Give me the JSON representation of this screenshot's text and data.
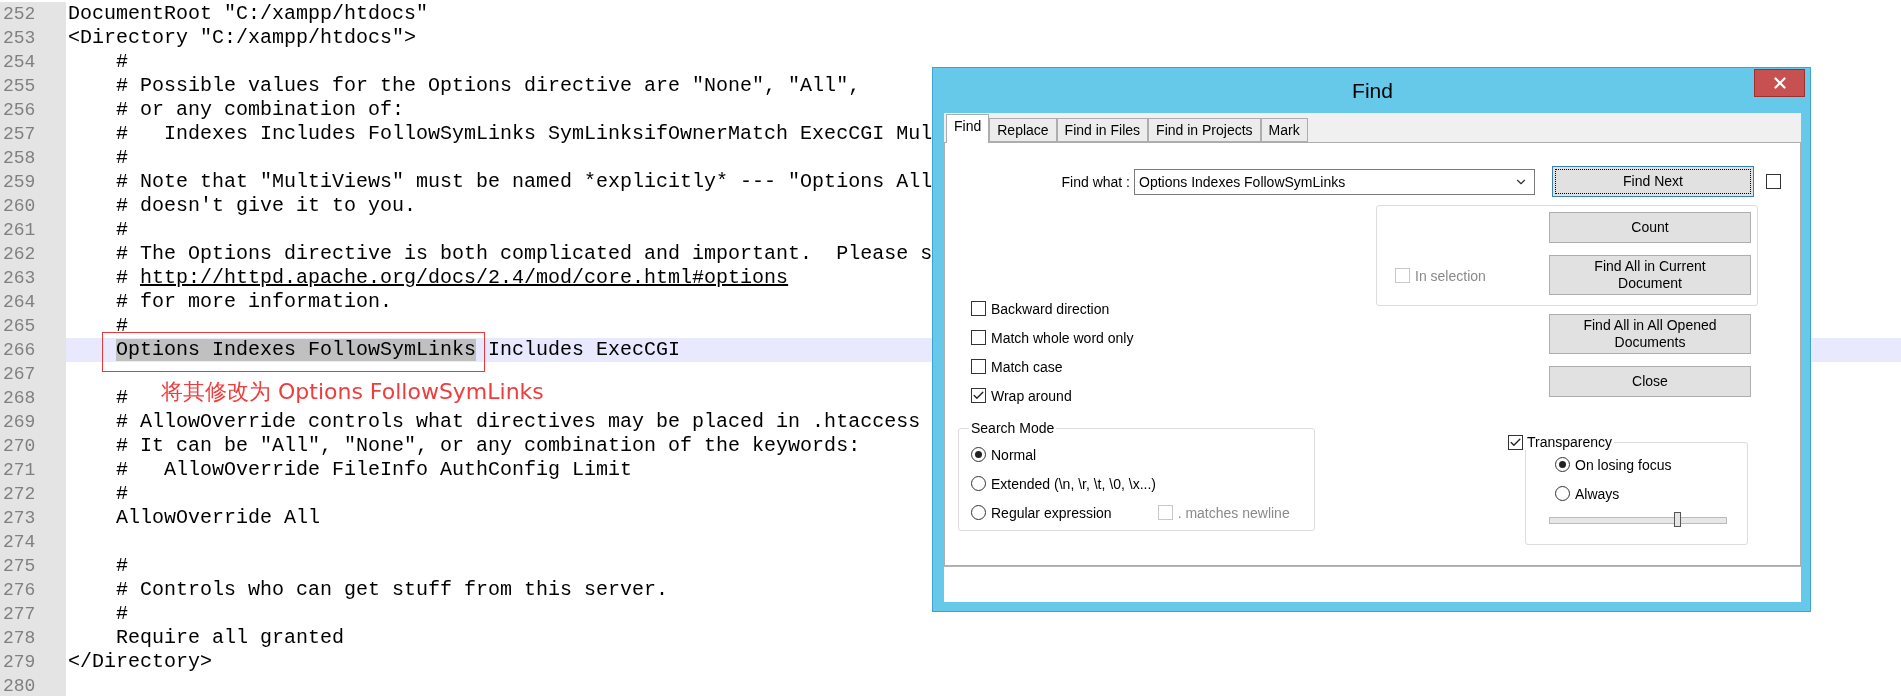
{
  "editor": {
    "lines": [
      {
        "number": "252",
        "current": false,
        "segments": [
          {
            "kind": "plain",
            "text": "DocumentRoot \"C:/xampp/htdocs\""
          }
        ]
      },
      {
        "number": "253",
        "current": false,
        "segments": [
          {
            "kind": "plain",
            "text": "<Directory \"C:/xampp/htdocs\">"
          }
        ]
      },
      {
        "number": "254",
        "current": false,
        "segments": [
          {
            "kind": "plain",
            "text": "    #"
          }
        ]
      },
      {
        "number": "255",
        "current": false,
        "segments": [
          {
            "kind": "plain",
            "text": "    # Possible values for the Options directive are \"None\", \"All\","
          }
        ]
      },
      {
        "number": "256",
        "current": false,
        "segments": [
          {
            "kind": "plain",
            "text": "    # or any combination of:"
          }
        ]
      },
      {
        "number": "257",
        "current": false,
        "segments": [
          {
            "kind": "plain",
            "text": "    #   Indexes Includes FollowSymLinks SymLinksifOwnerMatch ExecCGI Mul"
          }
        ]
      },
      {
        "number": "258",
        "current": false,
        "segments": [
          {
            "kind": "plain",
            "text": "    #"
          }
        ]
      },
      {
        "number": "259",
        "current": false,
        "segments": [
          {
            "kind": "plain",
            "text": "    # Note that \"MultiViews\" must be named *explicitly* --- \"Options All"
          }
        ]
      },
      {
        "number": "260",
        "current": false,
        "segments": [
          {
            "kind": "plain",
            "text": "    # doesn't give it to you."
          }
        ]
      },
      {
        "number": "261",
        "current": false,
        "segments": [
          {
            "kind": "plain",
            "text": "    #"
          }
        ]
      },
      {
        "number": "262",
        "current": false,
        "segments": [
          {
            "kind": "plain",
            "text": "    # The Options directive is both complicated and important.  Please s"
          }
        ]
      },
      {
        "number": "263",
        "current": false,
        "segments": [
          {
            "kind": "plain",
            "text": "    # "
          },
          {
            "kind": "link",
            "text": "http://httpd.apache.org/docs/2.4/mod/core.html#options"
          }
        ]
      },
      {
        "number": "264",
        "current": false,
        "segments": [
          {
            "kind": "plain",
            "text": "    # for more information."
          }
        ]
      },
      {
        "number": "265",
        "current": false,
        "segments": [
          {
            "kind": "plain",
            "text": "    #"
          }
        ]
      },
      {
        "number": "266",
        "current": true,
        "indented": true,
        "segments": [
          {
            "kind": "selection",
            "text": "Options Indexes FollowSymLinks"
          },
          {
            "kind": "plain",
            "text": " Includes ExecCGI"
          }
        ]
      },
      {
        "number": "267",
        "current": false
      },
      {
        "number": "268",
        "current": false,
        "segments": [
          {
            "kind": "plain",
            "text": "    #"
          }
        ]
      },
      {
        "number": "269",
        "current": false,
        "segments": [
          {
            "kind": "plain",
            "text": "    # AllowOverride controls what directives may be placed in .htaccess"
          }
        ]
      },
      {
        "number": "270",
        "current": false,
        "segments": [
          {
            "kind": "plain",
            "text": "    # It can be \"All\", \"None\", or any combination of the keywords:"
          }
        ]
      },
      {
        "number": "271",
        "current": false,
        "segments": [
          {
            "kind": "plain",
            "text": "    #   AllowOverride FileInfo AuthConfig Limit"
          }
        ]
      },
      {
        "number": "272",
        "current": false,
        "segments": [
          {
            "kind": "plain",
            "text": "    #"
          }
        ]
      },
      {
        "number": "273",
        "current": false,
        "segments": [
          {
            "kind": "plain",
            "text": "    AllowOverride All"
          }
        ]
      },
      {
        "number": "274",
        "current": false
      },
      {
        "number": "275",
        "current": false,
        "segments": [
          {
            "kind": "plain",
            "text": "    #"
          }
        ]
      },
      {
        "number": "276",
        "current": false,
        "segments": [
          {
            "kind": "plain",
            "text": "    # Controls who can get stuff from this server."
          }
        ]
      },
      {
        "number": "277",
        "current": false,
        "segments": [
          {
            "kind": "plain",
            "text": "    #"
          }
        ]
      },
      {
        "number": "278",
        "current": false,
        "segments": [
          {
            "kind": "plain",
            "text": "    Require all granted"
          }
        ]
      },
      {
        "number": "279",
        "current": false,
        "segments": [
          {
            "kind": "plain",
            "text": "</Directory>"
          }
        ]
      },
      {
        "number": "280",
        "current": false
      }
    ],
    "annotation": {
      "note": "将其修改为 Options FollowSymLinks"
    }
  },
  "dialog": {
    "title": "Find",
    "tabs": [
      {
        "label": "Find",
        "selected": true
      },
      {
        "label": "Replace",
        "selected": false
      },
      {
        "label": "Find in Files",
        "selected": false
      },
      {
        "label": "Find in Projects",
        "selected": false
      },
      {
        "label": "Mark",
        "selected": false
      }
    ],
    "find_what": {
      "label": "Find what :",
      "value": "Options Indexes FollowSymLinks"
    },
    "side_checkbox": {
      "checked": false
    },
    "buttons": [
      {
        "label": "Find Next",
        "focused": true
      },
      {
        "label": "Count",
        "focused": false
      },
      {
        "label": "Find All in Current Document",
        "focused": false
      },
      {
        "label": "Find All in All Opened Documents",
        "focused": false
      },
      {
        "label": "Close",
        "focused": false
      }
    ],
    "in_selection": {
      "label": "In selection",
      "checked": false,
      "disabled": true
    },
    "options": [
      {
        "label": "Backward direction",
        "checked": false
      },
      {
        "label": "Match whole word only",
        "checked": false
      },
      {
        "label": "Match case",
        "checked": false
      },
      {
        "label": "Wrap around",
        "checked": true
      }
    ],
    "search_mode": {
      "title": "Search Mode",
      "modes": [
        {
          "label": "Normal",
          "selected": true
        },
        {
          "label": "Extended (\\n, \\r, \\t, \\0, \\x...)",
          "selected": false
        },
        {
          "label": "Regular expression",
          "selected": false
        }
      ],
      "matches_newline": {
        "label": ". matches newline",
        "checked": false,
        "disabled": true
      }
    },
    "transparency": {
      "label": "Transparency",
      "checked": true,
      "modes": [
        {
          "label": "On losing focus",
          "selected": true
        },
        {
          "label": "Always",
          "selected": false
        }
      ],
      "level": 0.72
    }
  }
}
